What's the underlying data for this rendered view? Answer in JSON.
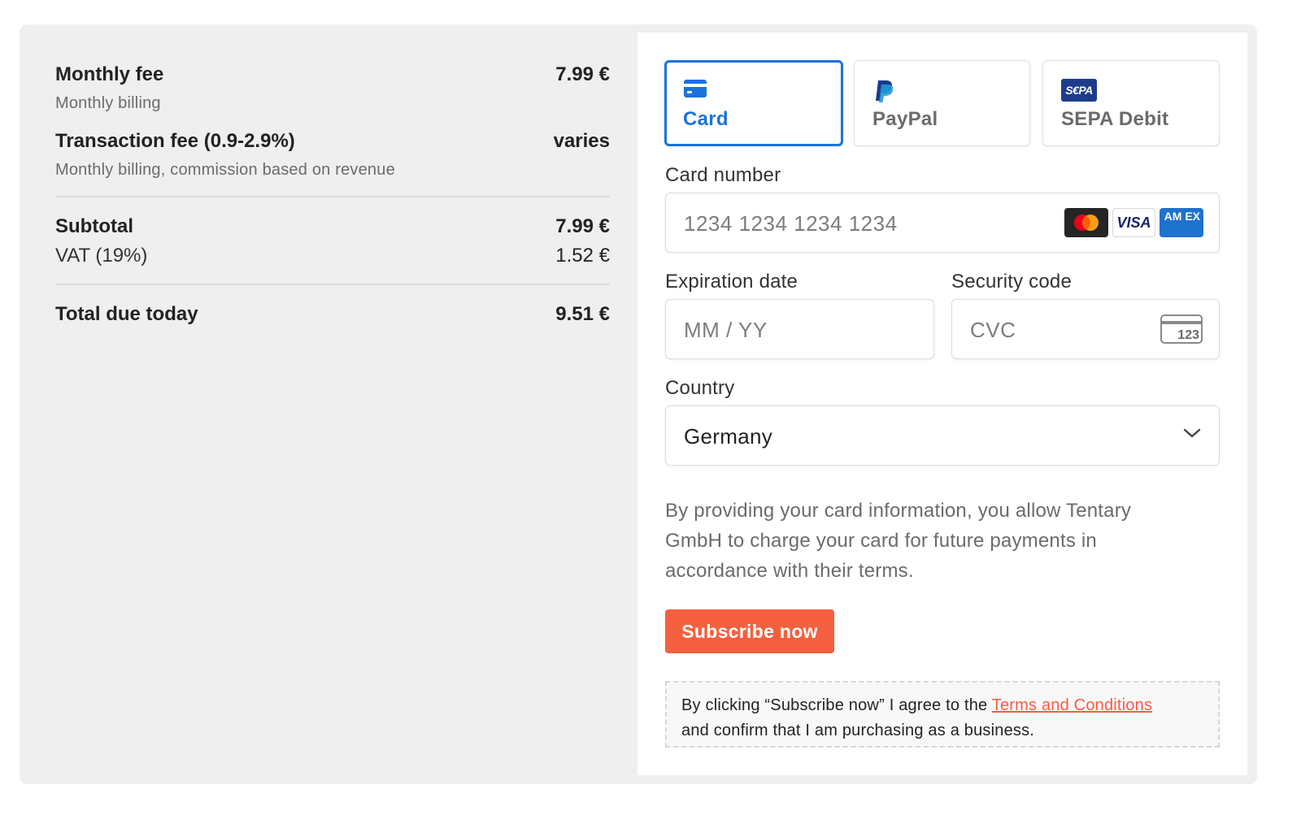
{
  "summary": {
    "monthly_fee": {
      "label": "Monthly fee",
      "sub": "Monthly billing",
      "amount": "7.99 €"
    },
    "transaction_fee": {
      "label": "Transaction fee (0.9-2.9%)",
      "sub": "Monthly billing, commission based on revenue",
      "amount": "varies"
    },
    "subtotal": {
      "label": "Subtotal",
      "amount": "7.99 €"
    },
    "vat": {
      "label": "VAT (19%)",
      "amount": "1.52 €"
    },
    "total": {
      "label": "Total due today",
      "amount": "9.51 €"
    }
  },
  "payment_methods": [
    {
      "label": "Card",
      "icon": "credit-card-icon",
      "selected": true
    },
    {
      "label": "PayPal",
      "icon": "paypal-icon",
      "selected": false
    },
    {
      "label": "SEPA Debit",
      "icon": "sepa-icon",
      "icon_text": "S€PA",
      "selected": false
    }
  ],
  "form": {
    "card_number": {
      "label": "Card number",
      "placeholder": "1234 1234 1234 1234"
    },
    "card_brands": [
      {
        "name": "mastercard-icon"
      },
      {
        "name": "visa-icon",
        "text": "VISA"
      },
      {
        "name": "amex-icon",
        "text": "AM EX"
      }
    ],
    "expiration": {
      "label": "Expiration date",
      "placeholder": "MM / YY"
    },
    "security": {
      "label": "Security code",
      "placeholder": "CVC",
      "icon_text": "123"
    },
    "country": {
      "label": "Country",
      "value": "Germany"
    }
  },
  "disclaimer": "By providing your card information, you allow Tentary GmbH to charge your card for future payments in accordance with their terms.",
  "subscribe_label": "Subscribe now",
  "terms": {
    "prefix": "By clicking “Subscribe now” I agree to the ",
    "link": "Terms and Conditions",
    "suffix": "and confirm that I am purchasing as a business."
  },
  "colors": {
    "accent": "#1a73d9",
    "cta": "#f4603f",
    "summary_bg": "#efefef"
  }
}
